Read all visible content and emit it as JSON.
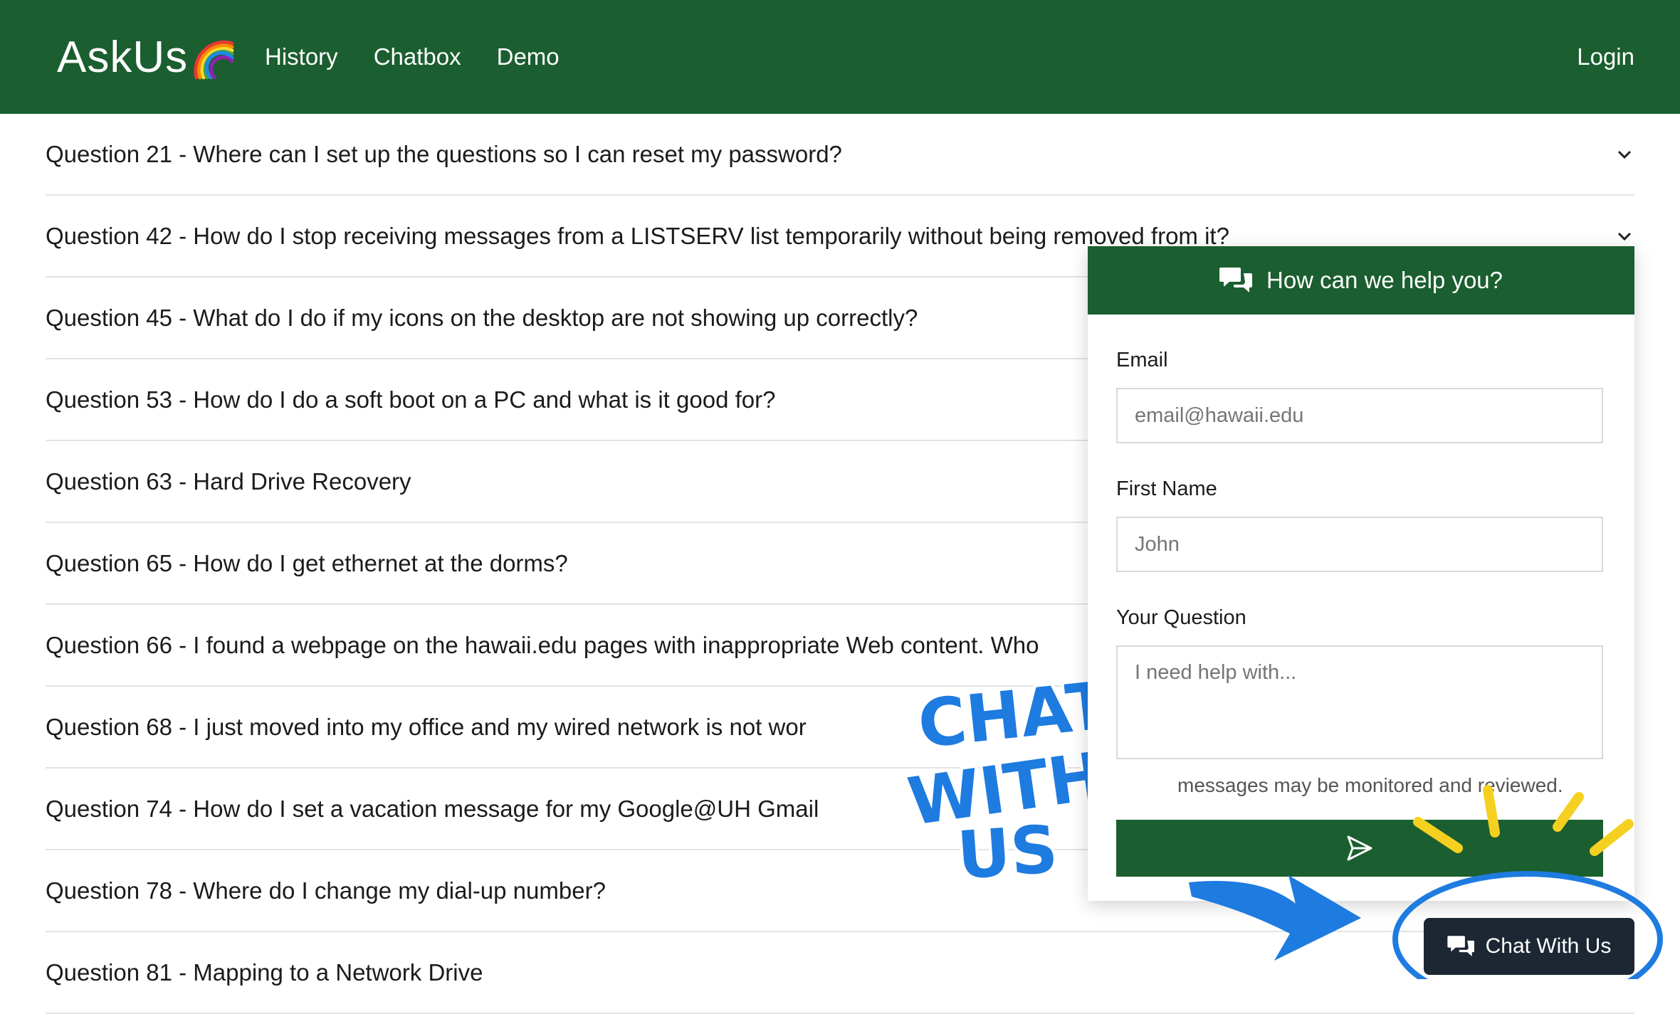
{
  "navbar": {
    "brand": "AskUs",
    "brand_emoji": "rainbow",
    "links": [
      "History",
      "Chatbox",
      "Demo"
    ],
    "login": "Login",
    "color": "#1b5e2f"
  },
  "questions": [
    "Question 21 - Where can I set up the questions so I can reset my password?",
    "Question 42 - How do I stop receiving messages from a LISTSERV list temporarily without being removed from it?",
    "Question 45 - What do I do if my icons on the desktop are not showing up correctly?",
    "Question 53 - How do I do a soft boot on a PC and what is it good for?",
    "Question 63 - Hard Drive Recovery",
    "Question 65 - How do I get ethernet at the dorms?",
    "Question 66 - I found a webpage on the hawaii.edu pages with inappropriate Web content. Who",
    "Question 68 - I just moved into my office and my wired network is not wor",
    "Question 74 - How do I set a vacation message for my Google@UH Gmail",
    "Question 78 - Where do I change my dial-up number?",
    "Question 81 - Mapping to a Network Drive"
  ],
  "chat": {
    "header": "How can we help you?",
    "email_label": "Email",
    "email_placeholder": "email@hawaii.edu",
    "first_name_label": "First Name",
    "first_name_placeholder": "John",
    "question_label": "Your Question",
    "question_placeholder": "I need help with...",
    "notice": "messages may be monitored and reviewed.",
    "send_icon": "send-icon"
  },
  "chat_button": {
    "label": "Chat With Us",
    "icon": "chat-bubbles-icon",
    "color": "#1c2733"
  },
  "sticker": {
    "lines": [
      "CHAT",
      "WITH",
      "US"
    ],
    "color": "#1e7be0"
  },
  "accent_colors": {
    "arrow": "#1e7be0",
    "sparkle": "#f5d020"
  }
}
